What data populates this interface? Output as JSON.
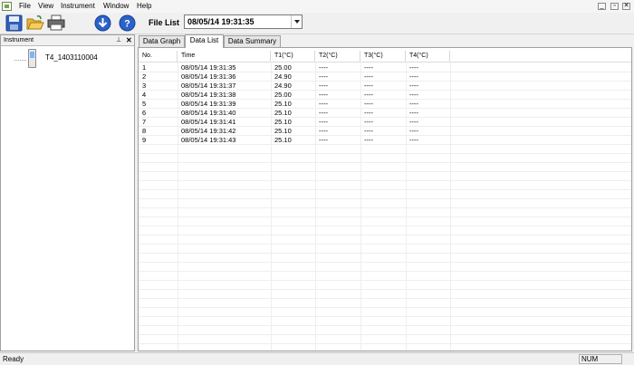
{
  "menu": {
    "items": [
      "File",
      "View",
      "Instrument",
      "Window",
      "Help"
    ]
  },
  "toolbar": {
    "file_list_label": "File List",
    "file_list_value": "08/05/14 19:31:35"
  },
  "instrument_panel": {
    "title": "Instrument",
    "pin_glyph": "⊥",
    "close_glyph": "✕",
    "device_name": "T4_1403110004"
  },
  "tabs": [
    "Data Graph",
    "Data List",
    "Data Summary"
  ],
  "active_tab": "Data List",
  "table": {
    "columns": [
      "No.",
      "Time",
      "T1(°C)",
      "T2(°C)",
      "T3(°C)",
      "T4(°C)"
    ],
    "rows": [
      [
        "1",
        "08/05/14 19:31:35",
        "25.00",
        "----",
        "----",
        "----"
      ],
      [
        "2",
        "08/05/14 19:31:36",
        "24.90",
        "----",
        "----",
        "----"
      ],
      [
        "3",
        "08/05/14 19:31:37",
        "24.90",
        "----",
        "----",
        "----"
      ],
      [
        "4",
        "08/05/14 19:31:38",
        "25.00",
        "----",
        "----",
        "----"
      ],
      [
        "5",
        "08/05/14 19:31:39",
        "25.10",
        "----",
        "----",
        "----"
      ],
      [
        "6",
        "08/05/14 19:31:40",
        "25.10",
        "----",
        "----",
        "----"
      ],
      [
        "7",
        "08/05/14 19:31:41",
        "25.10",
        "----",
        "----",
        "----"
      ],
      [
        "8",
        "08/05/14 19:31:42",
        "25.10",
        "----",
        "----",
        "----"
      ],
      [
        "9",
        "08/05/14 19:31:43",
        "25.10",
        "----",
        "----",
        "----"
      ]
    ]
  },
  "status": {
    "text": "Ready",
    "num": "NUM"
  },
  "icons": {
    "toolbar": [
      "save-icon",
      "open-folder-icon",
      "print-icon",
      "download-icon",
      "help-icon"
    ]
  }
}
